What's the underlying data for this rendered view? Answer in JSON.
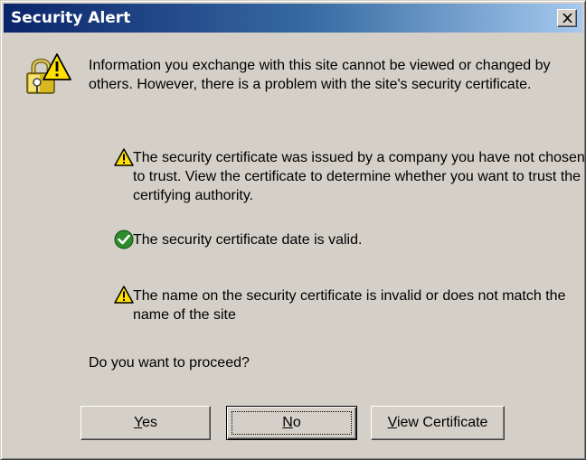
{
  "window": {
    "title": "Security Alert",
    "close_icon": "close-icon"
  },
  "message": {
    "intro": "Information you exchange with this site cannot be viewed or changed by others. However, there is a problem with the site's security certificate.",
    "icon": "lock-warning-icon"
  },
  "items": [
    {
      "icon": "warning-icon",
      "text": "The security certificate was issued by a company you have not chosen to trust. View the certificate to determine whether you want to trust the certifying authority."
    },
    {
      "icon": "check-icon",
      "text": "The security certificate date is valid."
    },
    {
      "icon": "warning-icon",
      "text": "The name on the security certificate is invalid or does not match the name of the site"
    }
  ],
  "question": "Do you want to proceed?",
  "buttons": {
    "yes": {
      "mnemonic": "Y",
      "rest": "es"
    },
    "no": {
      "mnemonic": "N",
      "rest": "o"
    },
    "view": {
      "mnemonic": "V",
      "rest": "iew Certificate"
    }
  },
  "colors": {
    "title_start": "#0a246a",
    "title_end": "#a6caf0",
    "face": "#d4d0c8",
    "warning_yellow": "#ffe000",
    "ok_green": "#2e8b2e"
  }
}
